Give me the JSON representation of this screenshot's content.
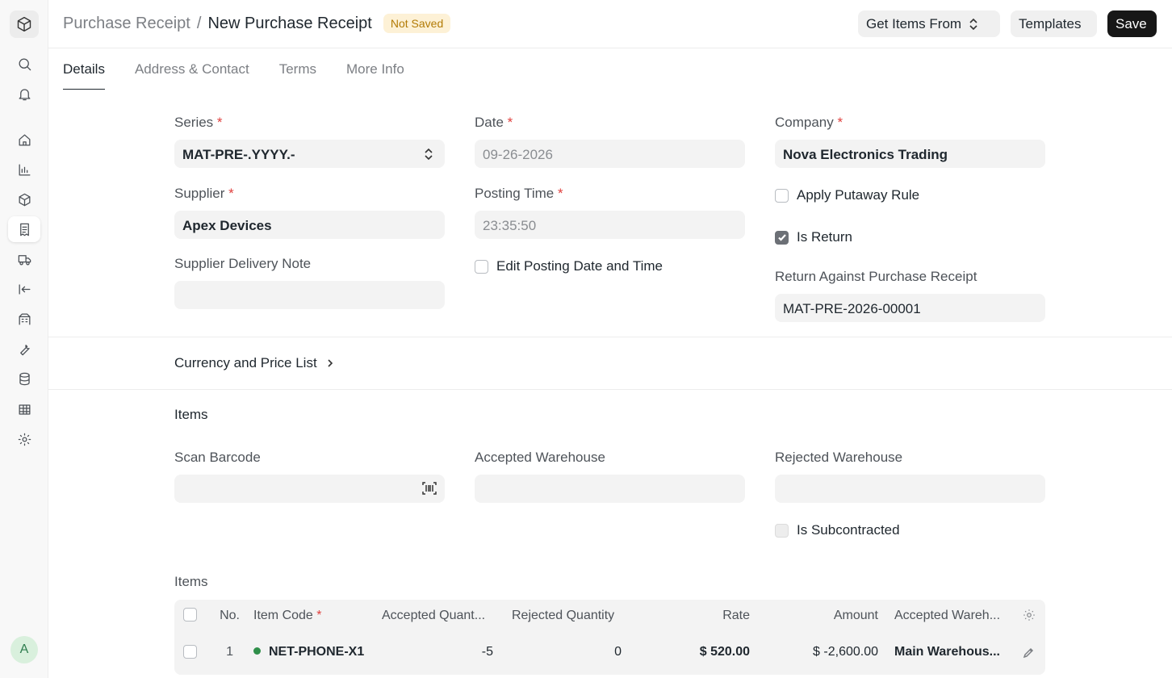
{
  "header": {
    "breadcrumb_parent": "Purchase Receipt",
    "breadcrumb_sep": "/",
    "title": "New Purchase Receipt",
    "status_badge": "Not Saved",
    "get_items_label": "Get Items From",
    "templates_label": "Templates",
    "save_label": "Save"
  },
  "sidebar": {
    "icons": [
      "app-logo-icon",
      "search-icon",
      "bell-icon",
      "home-icon",
      "chart-icon",
      "box-icon",
      "receipt-icon",
      "truck-icon",
      "arrow-left-bar-icon",
      "calculator-icon",
      "wrench-icon",
      "database-icon",
      "table-icon",
      "gear-icon"
    ],
    "active_icon": "receipt-icon",
    "avatar_letter": "A"
  },
  "tabs": [
    {
      "label": "Details",
      "active": true
    },
    {
      "label": "Address & Contact",
      "active": false
    },
    {
      "label": "Terms",
      "active": false
    },
    {
      "label": "More Info",
      "active": false
    }
  ],
  "form": {
    "series_label": "Series",
    "series_value": "MAT-PRE-.YYYY.-",
    "date_label": "Date",
    "date_value": "09-26-2026",
    "company_label": "Company",
    "company_value": "Nova Electronics Trading",
    "supplier_label": "Supplier",
    "supplier_value": "Apex Devices",
    "posting_time_label": "Posting Time",
    "posting_time_value": "23:35:50",
    "apply_putaway_label": "Apply Putaway Rule",
    "is_return_label": "Is Return",
    "supplier_delivery_note_label": "Supplier Delivery Note",
    "supplier_delivery_note_value": "",
    "edit_posting_label": "Edit Posting Date and Time",
    "return_against_label": "Return Against Purchase Receipt",
    "return_against_value": "MAT-PRE-2026-00001",
    "required_mark": "*"
  },
  "currency_section": {
    "title": "Currency and Price List"
  },
  "items_section": {
    "title": "Items",
    "scan_barcode_label": "Scan Barcode",
    "accepted_warehouse_label": "Accepted Warehouse",
    "rejected_warehouse_label": "Rejected Warehouse",
    "is_subcontracted_label": "Is Subcontracted",
    "table_label": "Items",
    "columns": [
      "No.",
      "Item Code",
      "Accepted Quant...",
      "Rejected Quantity",
      "Rate",
      "Amount",
      "Accepted Wareh..."
    ],
    "rows": [
      {
        "no": "1",
        "item_code": "NET-PHONE-X1",
        "accepted_qty": "-5",
        "rejected_qty": "0",
        "rate": "$ 520.00",
        "amount": "$ -2,600.00",
        "accepted_warehouse": "Main Warehous..."
      }
    ]
  },
  "colors": {
    "required": "#e0403e",
    "badge_bg": "#fdf1d6",
    "badge_text": "#b27b06",
    "save_bg": "#171717",
    "item_dot": "#2f8f4a"
  }
}
